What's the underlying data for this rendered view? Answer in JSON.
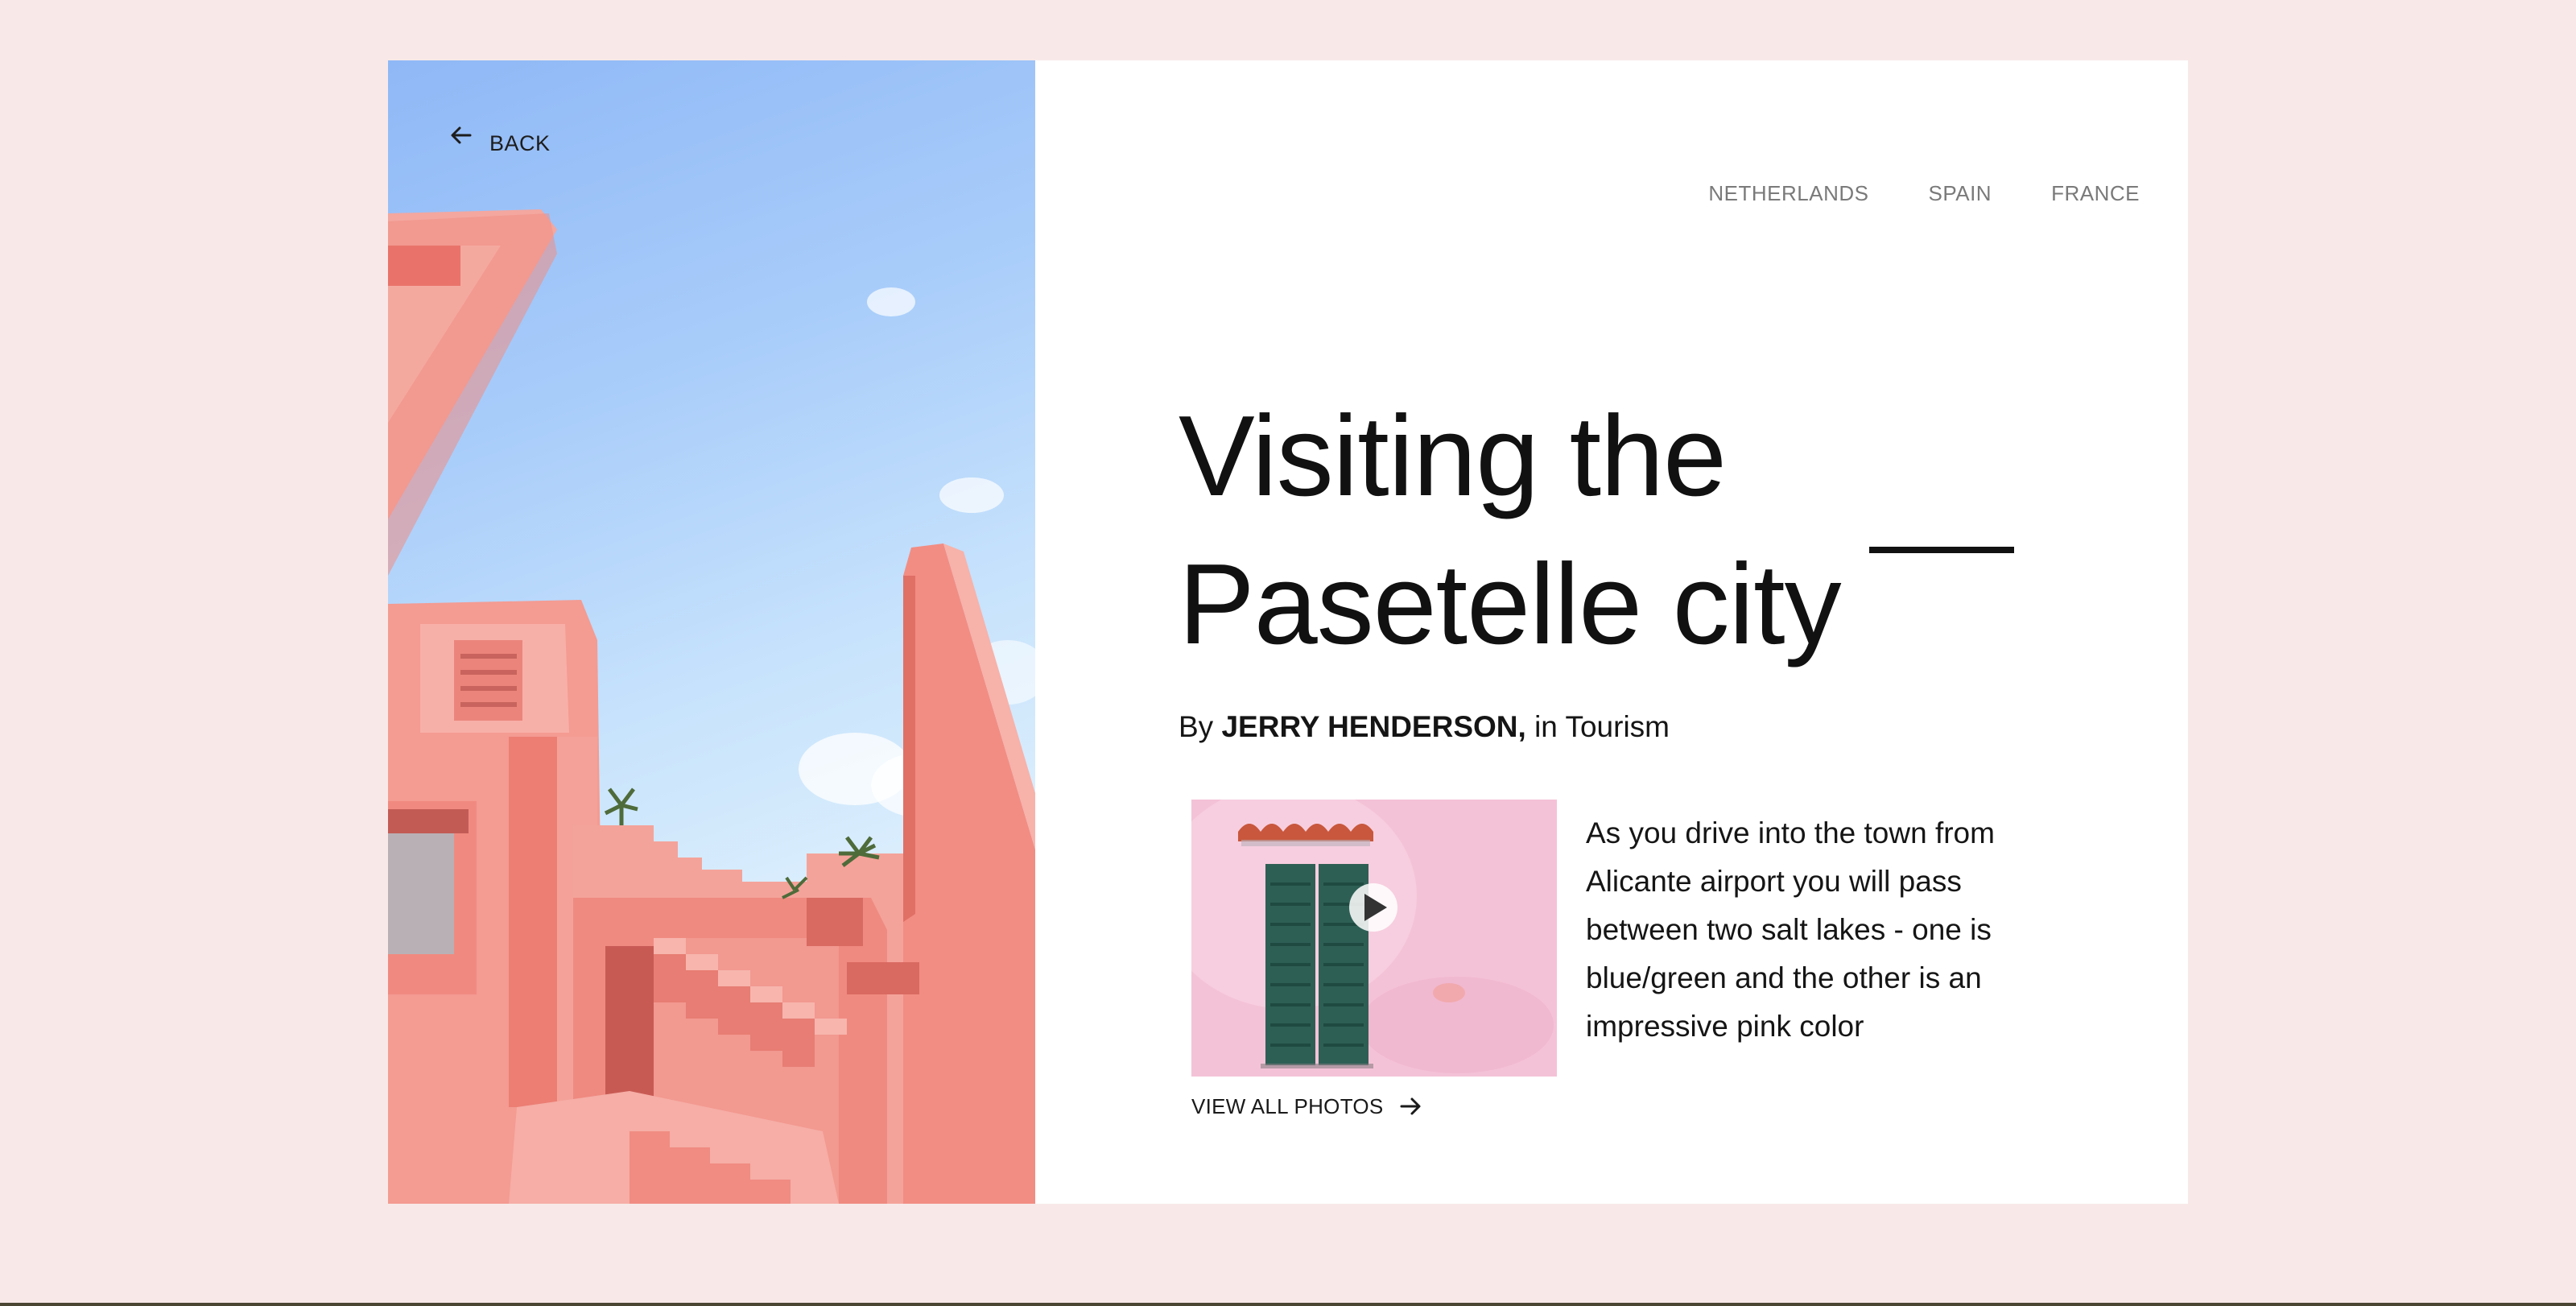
{
  "back": {
    "label": "BACK",
    "icon": "arrow-left-icon"
  },
  "nav": {
    "items": [
      {
        "label": "NETHERLANDS"
      },
      {
        "label": "SPAIN"
      },
      {
        "label": "FRANCE"
      }
    ]
  },
  "article": {
    "title_line1": "Visiting the",
    "title_line2": "Pasetelle city",
    "byline_prefix": "By",
    "author": "JERRY HENDERSON,",
    "byline_suffix": "in Tourism",
    "excerpt": "As you drive into the town from Alicante airport you will pass between two salt lakes - one is blue/green and the other is an impressive pink color"
  },
  "gallery": {
    "view_all_label": "VIEW ALL PHOTOS",
    "view_all_icon": "arrow-right-icon",
    "play_icon": "play-icon"
  },
  "colors": {
    "page_background": "#f8e9e8",
    "card_background": "#ffffff",
    "building_pink": "#f08a80",
    "sky_blue": "#a9cdfa",
    "shutter_green": "#2e5f55",
    "text_dark": "#111111",
    "nav_gray": "#7a7a7a"
  }
}
